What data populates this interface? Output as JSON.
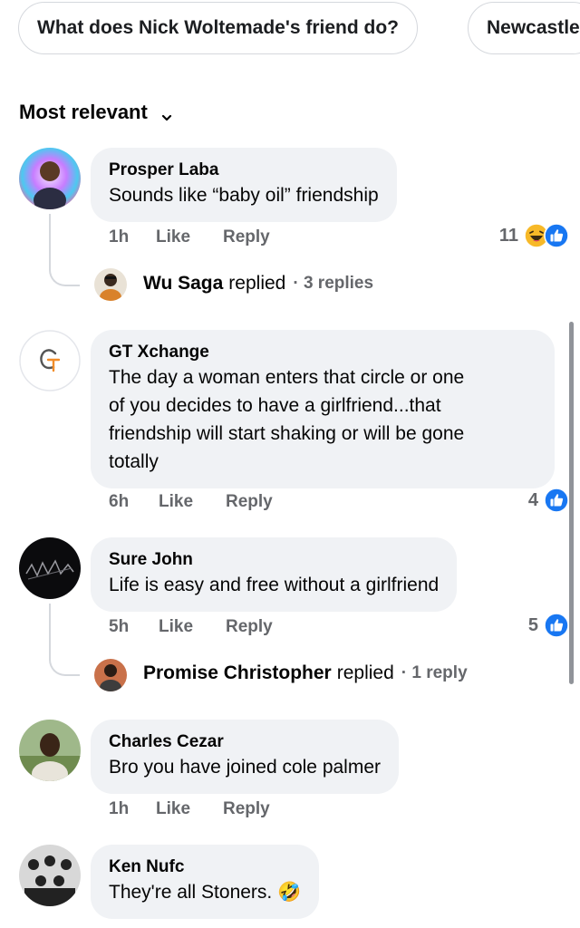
{
  "chips": [
    "What does Nick Woltemade's friend do?",
    "Newcastle"
  ],
  "sort_label": "Most relevant",
  "comments": [
    {
      "author": "Prosper Laba",
      "lines": [
        "Sounds like “baby oil” friendship"
      ],
      "time": "1h",
      "like": "Like",
      "reply": "Reply",
      "reactions": "11",
      "reaction_icons": [
        "haha-icon",
        "like-icon"
      ],
      "replies": {
        "name": "Wu Saga",
        "word": "replied",
        "count": "· 3 replies"
      }
    },
    {
      "author": "GT Xchange",
      "lines": [
        "The day a woman enters that circle or one",
        "of you decides to have a girlfriend...that",
        "friendship will start shaking or will be gone",
        "totally"
      ],
      "time": "6h",
      "like": "Like",
      "reply": "Reply",
      "reactions": "4",
      "reaction_icons": [
        "like-icon"
      ]
    },
    {
      "author": "Sure John",
      "lines": [
        "Life is easy and free without a girlfriend"
      ],
      "time": "5h",
      "like": "Like",
      "reply": "Reply",
      "reactions": "5",
      "reaction_icons": [
        "like-icon"
      ],
      "replies": {
        "name": "Promise Christopher",
        "word": "replied",
        "count": "· 1 reply"
      }
    },
    {
      "author": "Charles Cezar",
      "lines": [
        "Bro you have joined cole palmer"
      ],
      "time": "1h",
      "like": "Like",
      "reply": "Reply"
    },
    {
      "author": "Ken Nufc",
      "lines": [
        "They're all Stoners. 🤣"
      ],
      "time": "",
      "like": "",
      "reply": ""
    }
  ],
  "colors": {
    "like_blue": "#1877f2",
    "haha_yellow": "#f7b928",
    "muted": "#65676b",
    "bubble": "#f0f2f5"
  }
}
